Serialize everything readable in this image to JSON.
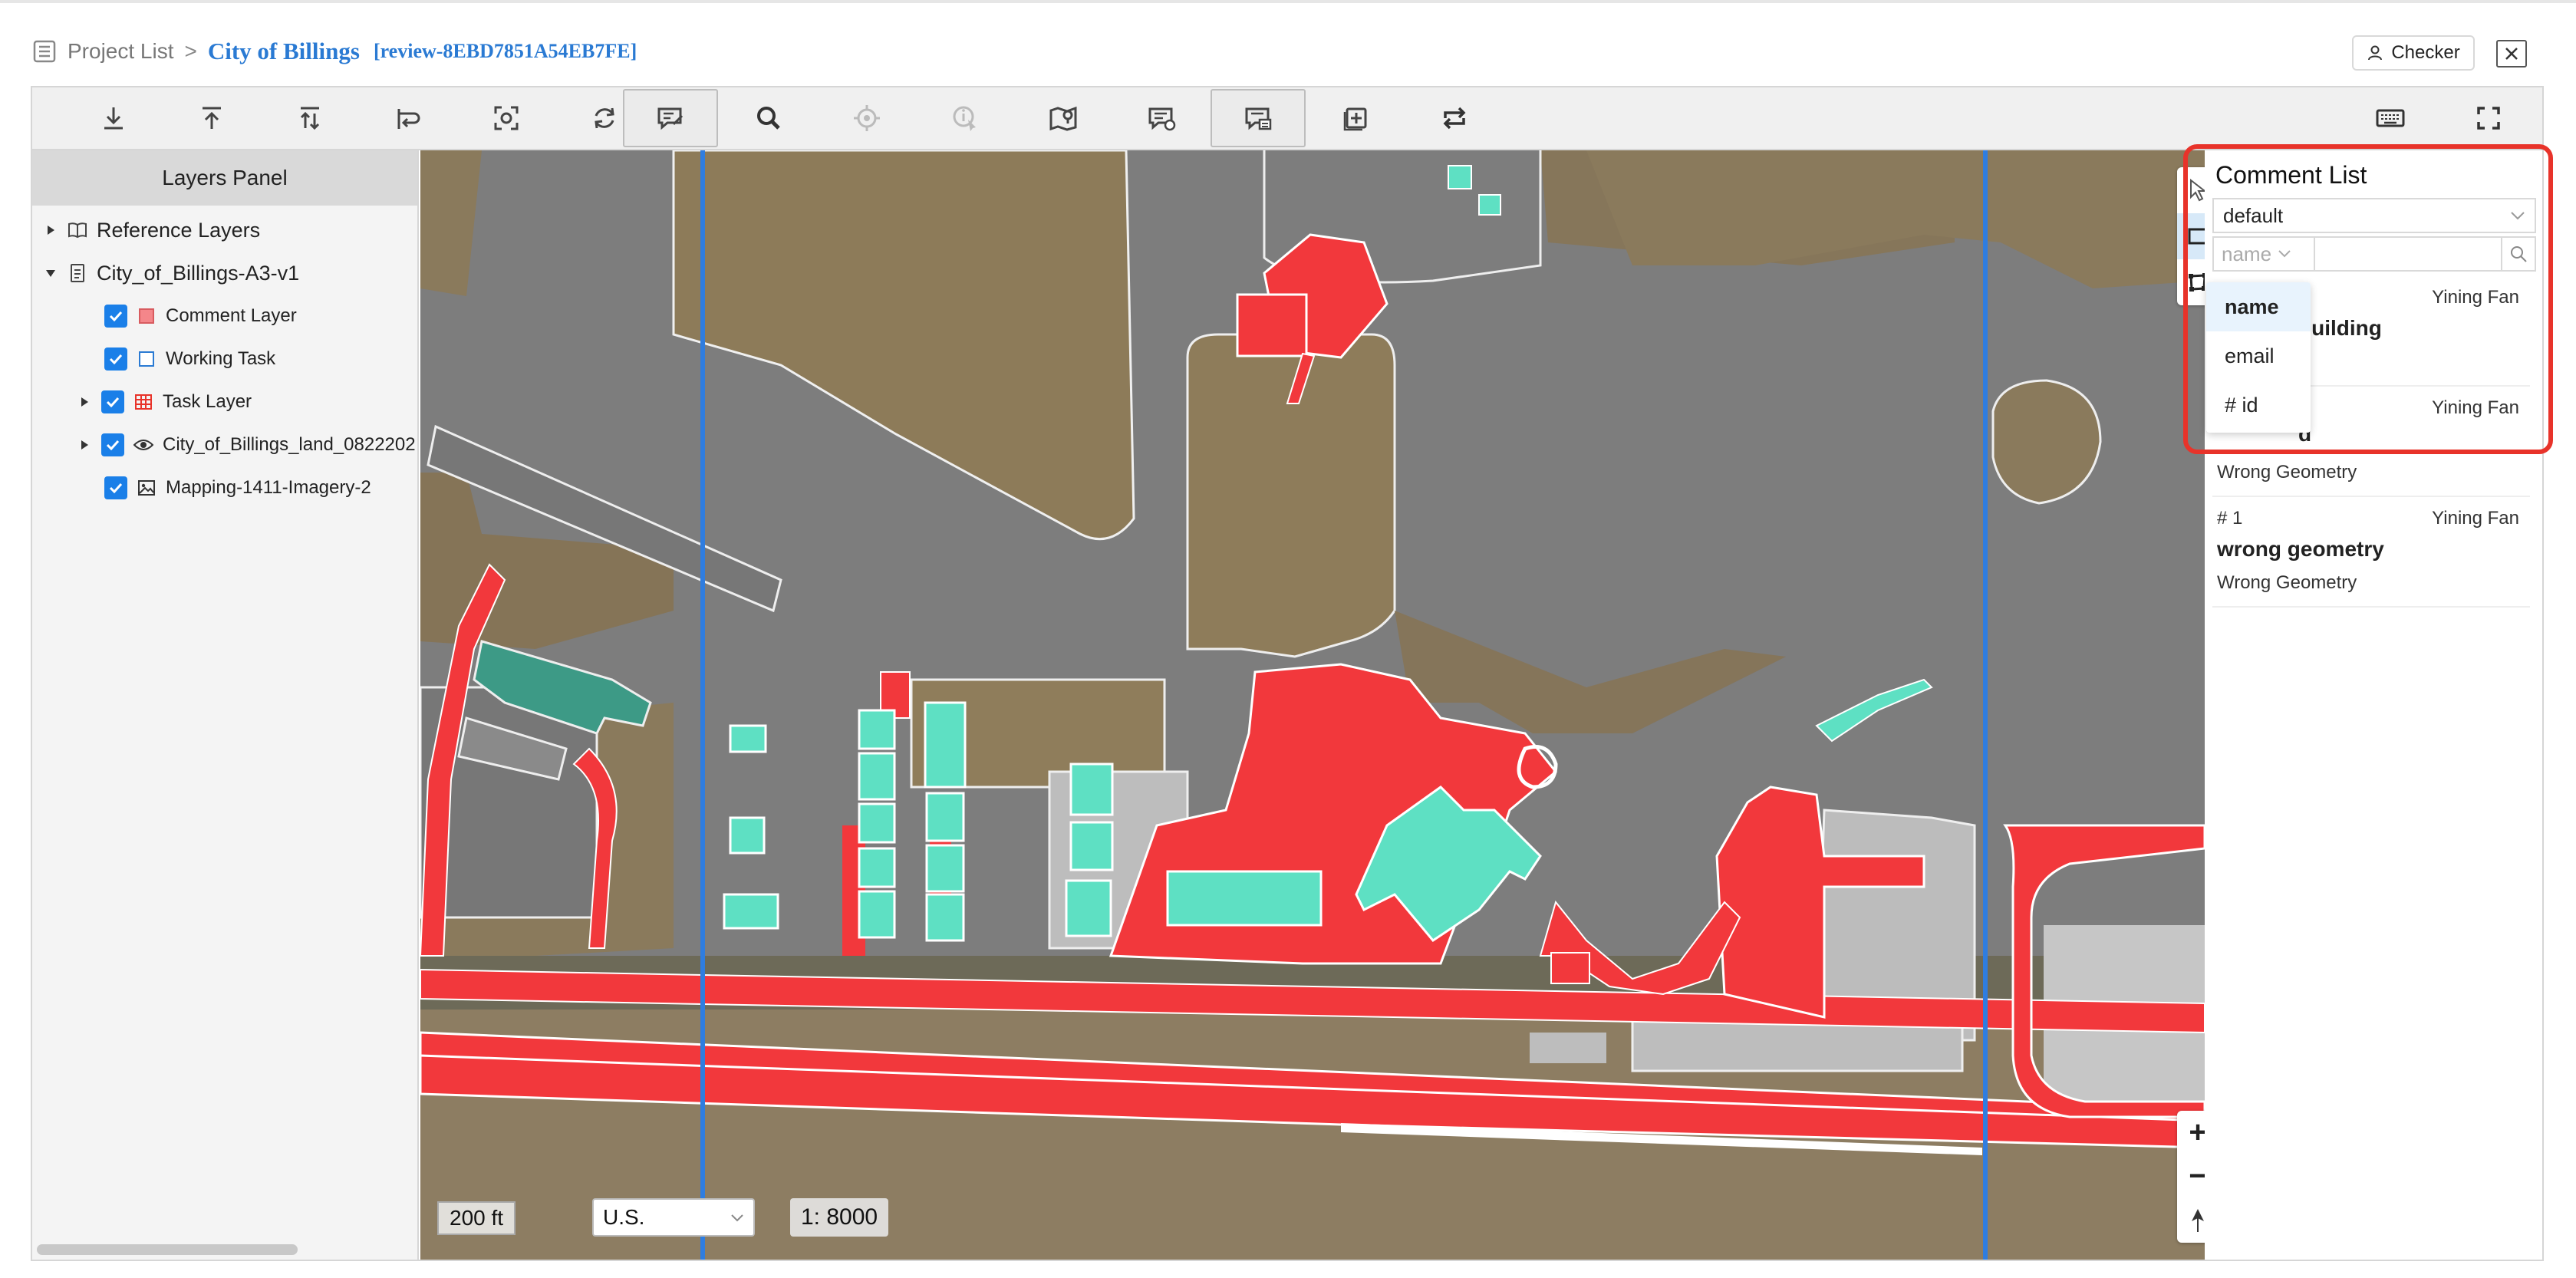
{
  "breadcrumb": {
    "project_list_label": "Project List",
    "separator": ">",
    "project_name": "City of Billings",
    "review_id": "[review-8EBD7851A54EB7FE]"
  },
  "header": {
    "checker_label": "Checker",
    "close_icon": "close-icon"
  },
  "toolbar": {
    "buttons": [
      {
        "name": "download-icon"
      },
      {
        "name": "upload-icon"
      },
      {
        "name": "merge-upload-icon"
      },
      {
        "name": "redirect-icon"
      },
      {
        "name": "focus-capture-icon"
      },
      {
        "name": "refresh-icon"
      },
      {
        "name": "edit-comment-icon",
        "active": true
      },
      {
        "name": "search-icon"
      },
      {
        "name": "locate-icon",
        "disabled": true
      },
      {
        "name": "identify-icon",
        "disabled": true
      },
      {
        "name": "map-marker-icon"
      },
      {
        "name": "comment-list-icon"
      },
      {
        "name": "comment-panel-icon",
        "active": true
      },
      {
        "name": "add-layer-icon"
      },
      {
        "name": "swap-icon"
      }
    ],
    "right_buttons": [
      {
        "name": "keyboard-icon"
      },
      {
        "name": "fullscreen-icon"
      }
    ]
  },
  "layers_panel": {
    "title": "Layers Panel",
    "groups": [
      {
        "label": "Reference Layers",
        "expanded": false
      },
      {
        "label": "City_of_Billings-A3-v1",
        "expanded": true
      }
    ],
    "layers": [
      {
        "label": "Comment Layer",
        "checked": true,
        "expandable": false
      },
      {
        "label": "Working Task",
        "checked": true,
        "expandable": false
      },
      {
        "label": "Task Layer",
        "checked": true,
        "expandable": true
      },
      {
        "label": "City_of_Billings_land_0822202",
        "checked": true,
        "expandable": true
      },
      {
        "label": "Mapping-1411-Imagery-2",
        "checked": true,
        "expandable": false
      }
    ]
  },
  "map": {
    "scale_label": "200 ft",
    "units_value": "U.S.",
    "ratio_label": "1: 8000",
    "zoom_in": "+",
    "zoom_out": "−"
  },
  "comment_panel": {
    "title": "Comment List",
    "filter_value": "default",
    "search_field": "name",
    "search_placeholder": "",
    "field_options": [
      "name",
      "email",
      "# id"
    ],
    "selected_option": "name",
    "comments": [
      {
        "id": "",
        "user": "Yining Fan",
        "title": "building",
        "type": ""
      },
      {
        "id": "",
        "user": "Yining Fan",
        "title": "d",
        "type": "Wrong Geometry"
      },
      {
        "id": "# 1",
        "user": "Yining Fan",
        "title": "wrong geometry",
        "type": "Wrong Geometry"
      }
    ]
  },
  "colors": {
    "accent": "#2a7ad3",
    "checkbox": "#1a7fe8",
    "highlight_border": "#e8332a",
    "feature_red": "#f2383c",
    "feature_teal": "#5ee0c3"
  }
}
